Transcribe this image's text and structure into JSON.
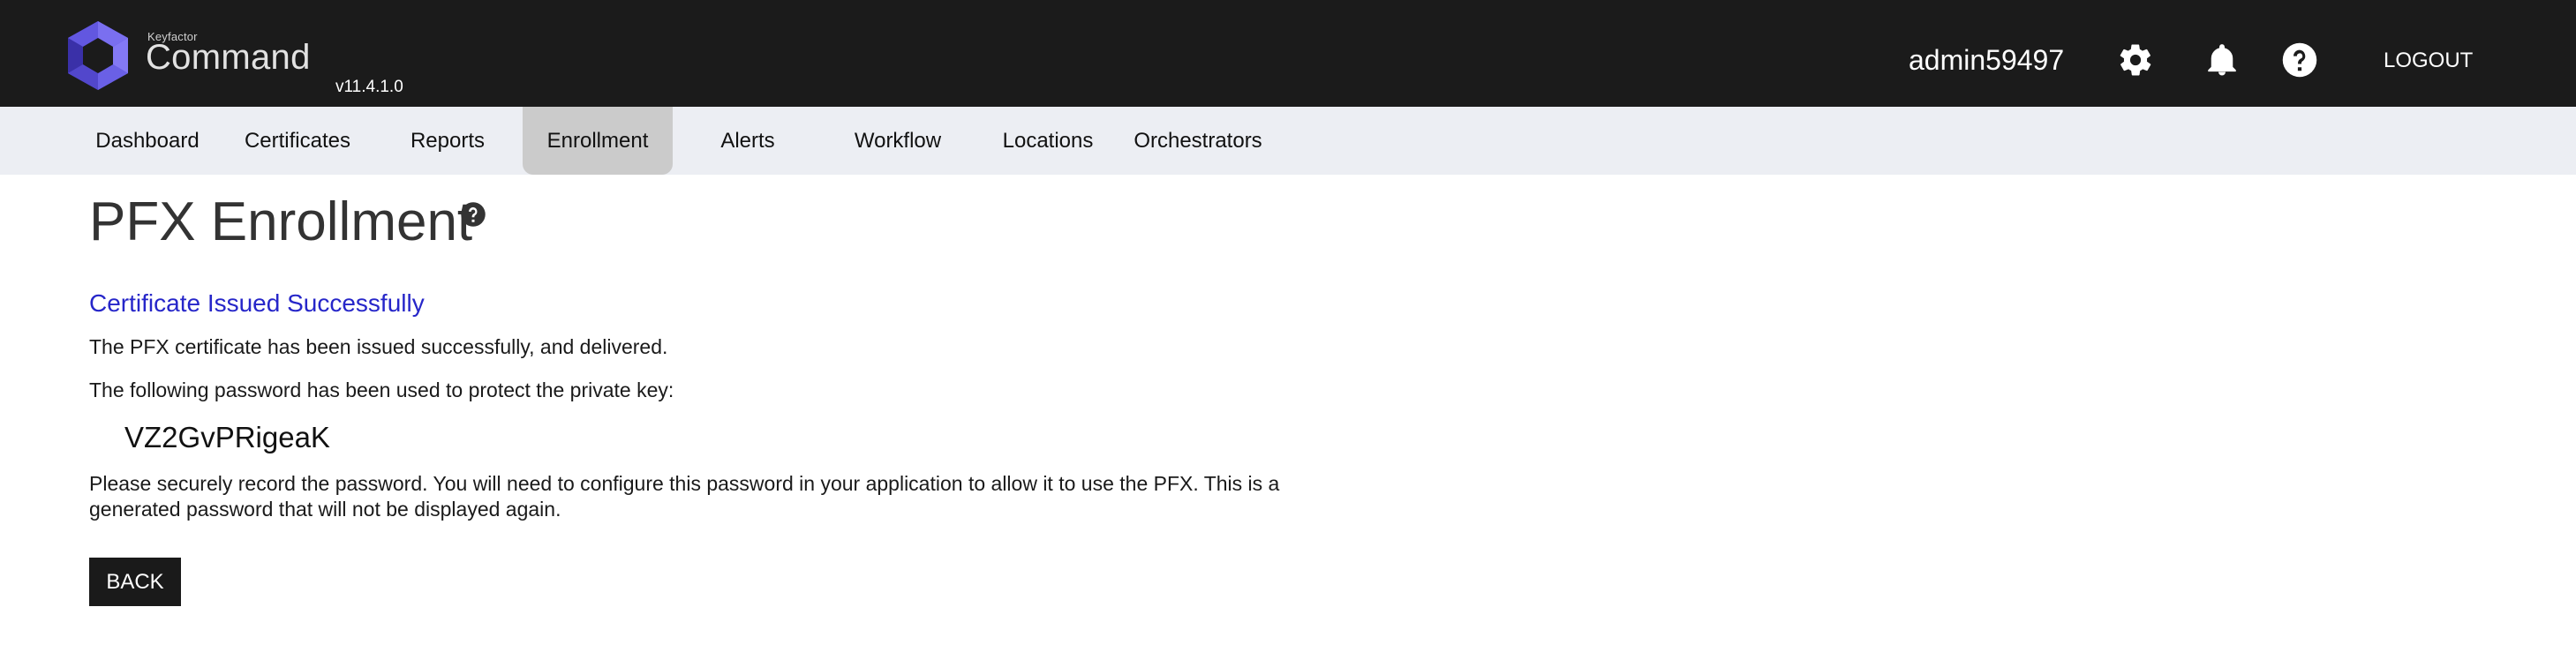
{
  "header": {
    "brand_small": "Keyfactor",
    "brand_name": "Command",
    "version": "v11.4.1.0",
    "username": "admin59497",
    "logout_label": "LOGOUT",
    "icons": [
      "settings-gear-icon",
      "notifications-bell-icon",
      "help-question-icon"
    ]
  },
  "nav": {
    "items": [
      {
        "label": "Dashboard"
      },
      {
        "label": "Certificates"
      },
      {
        "label": "Reports"
      },
      {
        "label": "Enrollment",
        "active": true
      },
      {
        "label": "Alerts"
      },
      {
        "label": "Workflow"
      },
      {
        "label": "Locations"
      },
      {
        "label": "Orchestrators"
      }
    ]
  },
  "main": {
    "title": "PFX Enrollment",
    "success_heading": "Certificate Issued Successfully",
    "issued_message": "The PFX certificate has been issued successfully, and delivered.",
    "password_intro": "The following password has been used to protect the private key:",
    "password": "VZ2GvPRigeaK",
    "record_message_line1": "Please securely record the password. You will need to configure this password in your application to allow it to use the PFX. This is a",
    "record_message_line2": "generated password that will not be displayed again.",
    "back_label": "BACK"
  },
  "colors": {
    "header_bg": "#1b1b1b",
    "nav_bg": "#eceef3",
    "nav_active_bg": "#cbcbcb",
    "success_heading": "#2626c9",
    "logo_primary": "#5b4fd6",
    "logo_secondary": "#3f35b0"
  }
}
